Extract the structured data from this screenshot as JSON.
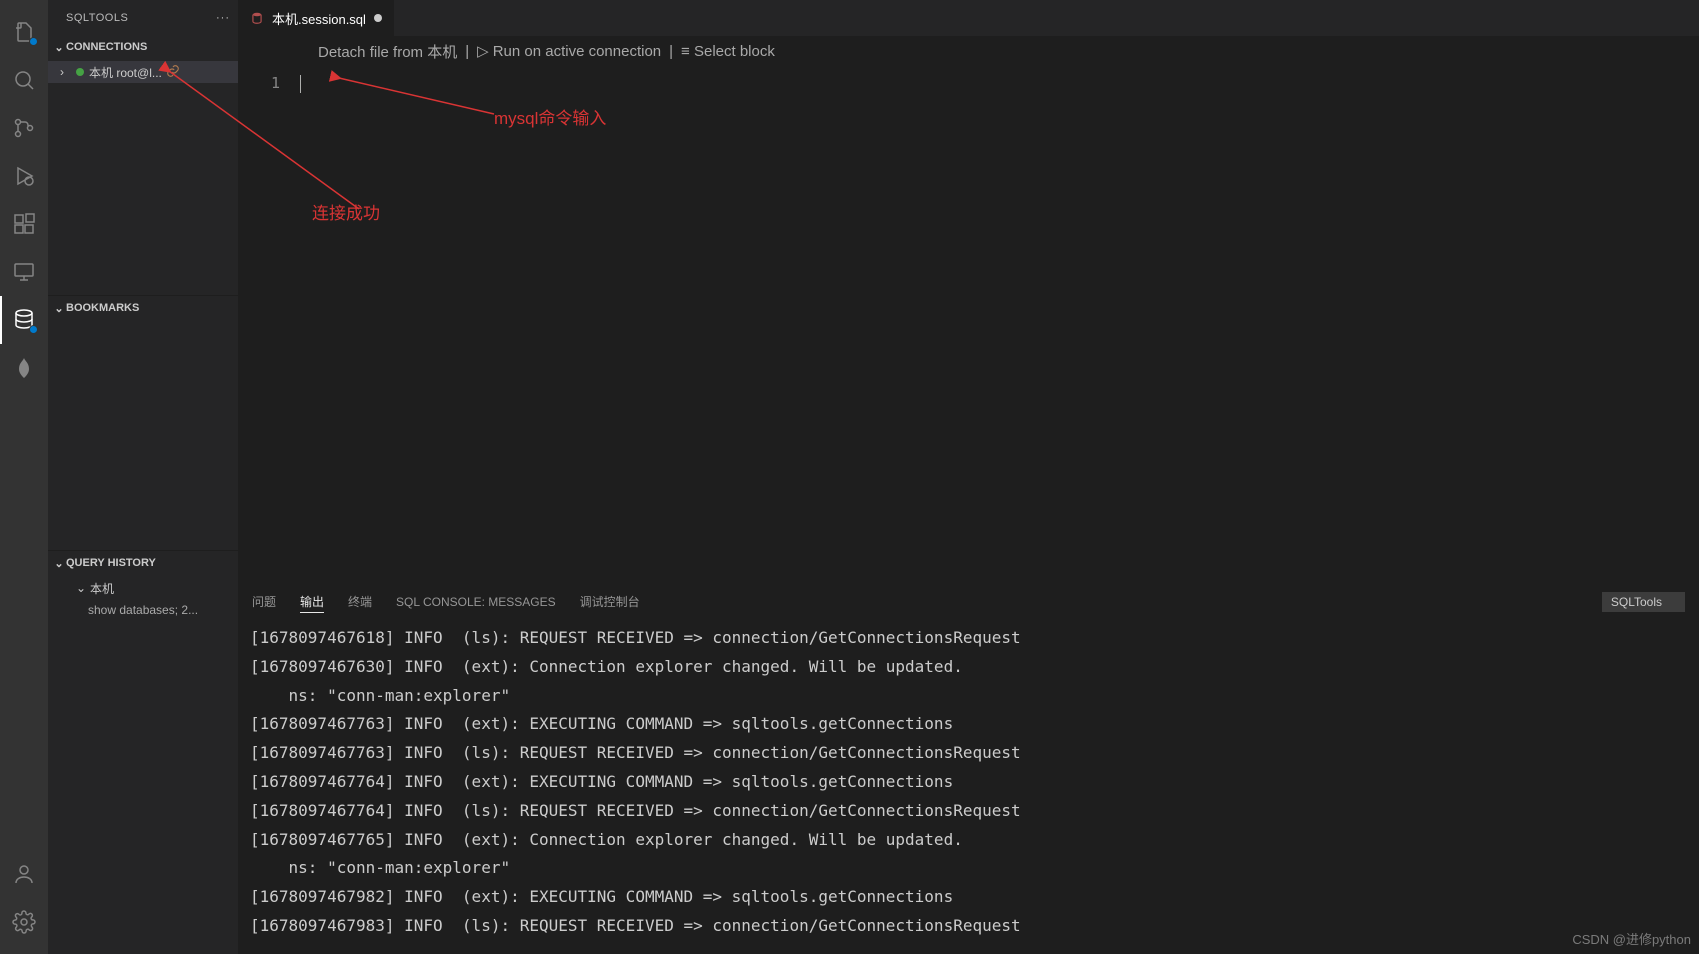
{
  "sidebar": {
    "title": "SQLTOOLS",
    "sections": {
      "connections": {
        "label": "CONNECTIONS",
        "items": [
          {
            "label": "本机  root@l...",
            "connected": true
          }
        ]
      },
      "bookmarks": {
        "label": "BOOKMARKS"
      },
      "queryHistory": {
        "label": "QUERY HISTORY",
        "groupLabel": "本机",
        "items": [
          {
            "label": "show databases;  2..."
          }
        ]
      }
    }
  },
  "tab": {
    "label": "本机.session.sql",
    "modified": true
  },
  "breadcrumb": {
    "detach_prefix": "Detach file from ",
    "detach_target": "本机",
    "run": "Run on active connection",
    "select_block": "Select block"
  },
  "editor": {
    "line_number": "1"
  },
  "panel": {
    "tabs": {
      "problems": "问题",
      "output": "输出",
      "terminal": "终端",
      "sql_console": "SQL CONSOLE: MESSAGES",
      "debug_console": "调试控制台"
    },
    "selector": "SQLTools",
    "output_lines": [
      "[1678097467618] INFO  (ls): REQUEST RECEIVED => connection/GetConnectionsRequest",
      "[1678097467630] INFO  (ext): Connection explorer changed. Will be updated.",
      "    ns: \"conn-man:explorer\"",
      "[1678097467763] INFO  (ext): EXECUTING COMMAND => sqltools.getConnections",
      "[1678097467763] INFO  (ls): REQUEST RECEIVED => connection/GetConnectionsRequest",
      "[1678097467764] INFO  (ext): EXECUTING COMMAND => sqltools.getConnections",
      "[1678097467764] INFO  (ls): REQUEST RECEIVED => connection/GetConnectionsRequest",
      "[1678097467765] INFO  (ext): Connection explorer changed. Will be updated.",
      "    ns: \"conn-man:explorer\"",
      "[1678097467982] INFO  (ext): EXECUTING COMMAND => sqltools.getConnections",
      "[1678097467983] INFO  (ls): REQUEST RECEIVED => connection/GetConnectionsRequest"
    ]
  },
  "annotations": {
    "conn_success": "连接成功",
    "mysql_input": "mysql命令输入"
  },
  "watermark": "CSDN @进修python"
}
